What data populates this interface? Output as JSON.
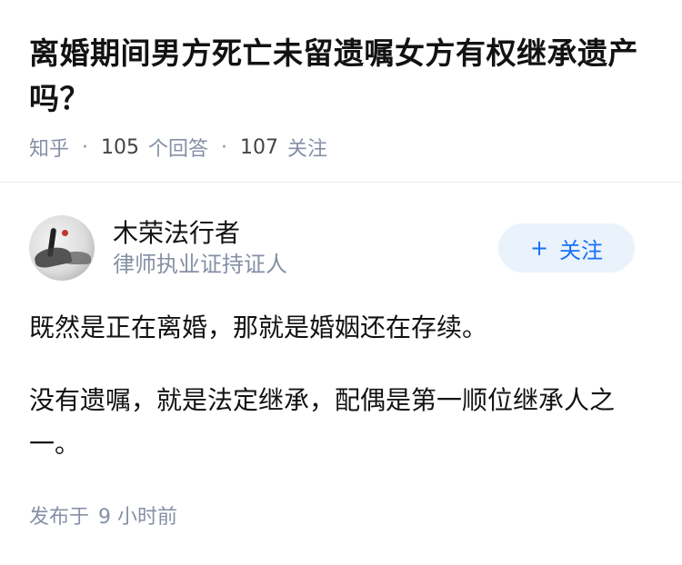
{
  "question": {
    "title": "离婚期间男方死亡未留遗嘱女方有权继承遗产吗？",
    "source": "知乎",
    "answers_count": "105",
    "answers_label": "个回答",
    "followers_count": "107",
    "followers_label": "关注"
  },
  "answer": {
    "author_name": "木荣法行者",
    "author_badge": "律师执业证持证人",
    "follow_label": "关注",
    "follow_icon": "plus",
    "paragraphs": [
      "既然是正在离婚，那就是婚姻还在存续。",
      "没有遗嘱，就是法定继承，配偶是第一顺位继承人之一。"
    ],
    "published_label": "发布于",
    "published_time": "9 小时前"
  },
  "colors": {
    "accent": "#1772f6",
    "follow_bg": "#eaf2fc",
    "meta_gray": "#8590a6"
  }
}
